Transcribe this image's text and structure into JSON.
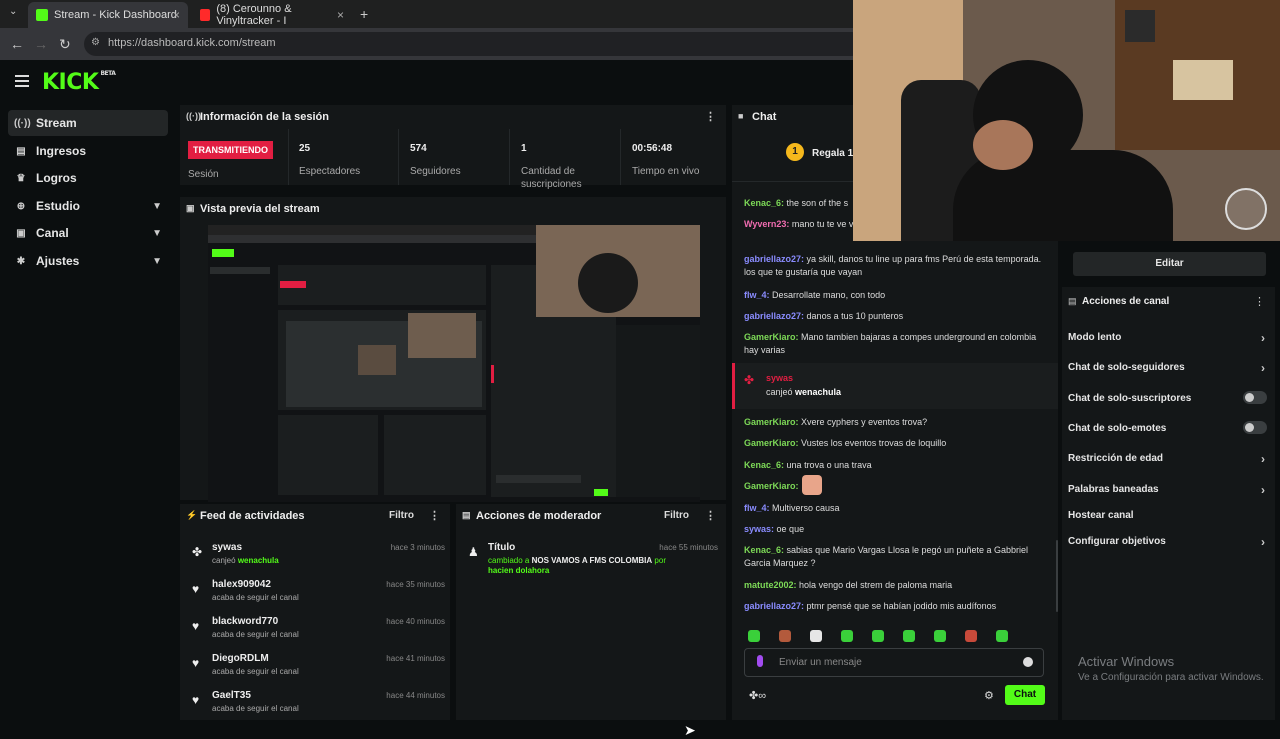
{
  "browser": {
    "tabs": [
      {
        "title": "Stream - Kick Dashboard",
        "close": "×"
      },
      {
        "title": "(8) Cerounno & Vinyltracker - I",
        "close": "×"
      }
    ],
    "new_tab": "+",
    "url": "https://dashboard.kick.com/stream"
  },
  "app": {
    "logo": "KICK",
    "logo_badge": "BETA",
    "sidebar": {
      "items": [
        {
          "label": "Stream",
          "icon": "stream-icon"
        },
        {
          "label": "Ingresos",
          "icon": "wallet-icon"
        },
        {
          "label": "Logros",
          "icon": "trophy-icon"
        },
        {
          "label": "Estudio",
          "icon": "studio-icon"
        },
        {
          "label": "Canal",
          "icon": "channel-icon"
        },
        {
          "label": "Ajustes",
          "icon": "gear-icon"
        }
      ]
    },
    "session": {
      "title": "Información de la sesión",
      "live_badge": "TRANSMITIENDO",
      "live_label": "Sesión",
      "stats": [
        {
          "value": "25",
          "label": "Espectadores"
        },
        {
          "value": "574",
          "label": "Seguidores"
        },
        {
          "value": "1",
          "label": "Cantidad de suscripciones"
        },
        {
          "value": "00:56:48",
          "label": "Tiempo en vivo"
        }
      ]
    },
    "preview": {
      "title": "Vista previa del stream"
    },
    "activity": {
      "title": "Feed de actividades",
      "filter": "Filtro",
      "items": [
        {
          "name": "sywas",
          "desc_prefix": "canjeó",
          "desc_highlight": "wenachula",
          "time": "hace 3 minutos",
          "icon": "redeem-icon"
        },
        {
          "name": "halex909042",
          "desc_prefix": "acaba de seguir el canal",
          "desc_highlight": "",
          "time": "hace 35 minutos",
          "icon": "heart-icon"
        },
        {
          "name": "blackword770",
          "desc_prefix": "acaba de seguir el canal",
          "desc_highlight": "",
          "time": "hace 40 minutos",
          "icon": "heart-icon"
        },
        {
          "name": "DiegoRDLM",
          "desc_prefix": "acaba de seguir el canal",
          "desc_highlight": "",
          "time": "hace 41 minutos",
          "icon": "heart-icon"
        },
        {
          "name": "GaelT35",
          "desc_prefix": "acaba de seguir el canal",
          "desc_highlight": "",
          "time": "hace 44 minutos",
          "icon": "heart-icon"
        }
      ]
    },
    "moderator": {
      "title": "Acciones de moderador",
      "filter": "Filtro",
      "item": {
        "name": "Título",
        "desc_prefix": "cambiado a",
        "desc_bold": "NOS VAMOS A FMS COLOMBIA",
        "desc_by": "por",
        "user": "hacien dolahora",
        "time": "hace 55 minutos"
      }
    },
    "chat": {
      "title": "Chat",
      "pinned": "Regala 1 s",
      "pinned_count": "1",
      "messages": [
        {
          "user": "Kenac_6:",
          "color": "#7dd957",
          "text": "the son of the s"
        },
        {
          "user": "Wyvern23:",
          "color": "#f06cb0",
          "text": "mano tu te ve varios te tiene bajo, callate, pesos"
        },
        {
          "user": "gabriellazo27:",
          "color": "#8a8cff",
          "text": "ya skill, danos tu line up para fms Perú de esta temporada. los que te gustaría que vayan"
        },
        {
          "user": "flw_4:",
          "color": "#8a8cff",
          "text": "Desarrollate mano, con todo"
        },
        {
          "user": "gabriellazo27:",
          "color": "#8a8cff",
          "text": "danos a tus 10 punteros"
        },
        {
          "user": "GamerKiaro:",
          "color": "#7dd957",
          "text": "Mano tambien bajaras a compes underground en colombia hay varias"
        },
        {
          "user": "GamerKiaro:",
          "color": "#7dd957",
          "text": "Xvere cyphers y eventos trova?"
        },
        {
          "user": "GamerKiaro:",
          "color": "#7dd957",
          "text": "Vustes los eventos trovas de loquillo"
        },
        {
          "user": "Kenac_6:",
          "color": "#7dd957",
          "text": "una trova o una trava"
        },
        {
          "user": "GamerKiaro:",
          "color": "#7dd957",
          "text": ""
        },
        {
          "user": "flw_4:",
          "color": "#8a8cff",
          "text": "Multiverso causa"
        },
        {
          "user": "sywas:",
          "color": "#8a8cff",
          "text": "oe que"
        },
        {
          "user": "Kenac_6:",
          "color": "#7dd957",
          "text": "sabias que Mario Vargas Llosa le pegó un puñete a Gabbriel Garcia Marquez ?"
        },
        {
          "user": "matute2002:",
          "color": "#7dd957",
          "text": "hola vengo del strem de paloma maria"
        },
        {
          "user": "gabriellazo27:",
          "color": "#8a8cff",
          "text": "ptmr pensé que se habían jodido mis audífonos"
        }
      ],
      "redeem": {
        "user": "sywas",
        "prefix": "canjeó",
        "reward": "wenachula"
      },
      "input_placeholder": "Enviar un mensaje",
      "send_label": "Chat"
    },
    "channel_actions": {
      "edit_label": "Editar",
      "title": "Acciones de canal",
      "items": [
        {
          "label": "Modo lento",
          "control": "chevron"
        },
        {
          "label": "Chat de solo-seguidores",
          "control": "chevron"
        },
        {
          "label": "Chat de solo-suscriptores",
          "control": "toggle"
        },
        {
          "label": "Chat de solo-emotes",
          "control": "toggle"
        },
        {
          "label": "Restricción de edad",
          "control": "chevron"
        },
        {
          "label": "Palabras baneadas",
          "control": "chevron"
        },
        {
          "label": "Hostear canal",
          "control": "none"
        },
        {
          "label": "Configurar objetivos",
          "control": "chevron"
        }
      ]
    },
    "windows_watermark": {
      "line1": "Activar Windows",
      "line2": "Ve a Configuración para activar Windows."
    }
  }
}
